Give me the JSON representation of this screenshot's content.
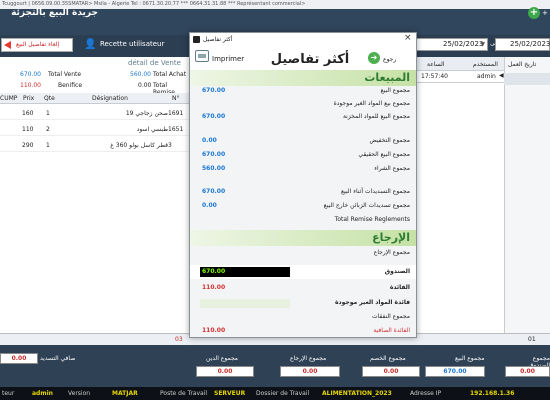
{
  "window": {
    "title_text": "Tcuggourt | 0656.09.00.35SMATAR> Msila - Algerie Tel : 0671.30.20.77 *** 0664.31.31.88 *** Représentant commercial>"
  },
  "header": {
    "app_title": "جريدة البيع بالتجزئة",
    "plus_label": "+"
  },
  "toolbar": {
    "cancel_label": "إلغاء تفاصيل البيع",
    "recette_label": "Recette utilisateur",
    "date_from_label": "من",
    "date_from": "25/02/2023",
    "date_to_label": "إلى",
    "date_to": "25/02/2023"
  },
  "left_panel": {
    "detail_title": "détail de Vente",
    "totals": [
      {
        "label_left": "Total Vente",
        "value_left": "670.00",
        "label_right": "Total Achat",
        "value_right": "560.00"
      },
      {
        "label_left": "Benifice",
        "value_left": "110.00",
        "label_right": "Total Remise",
        "value_right": "0.00"
      }
    ],
    "columns": [
      "CUMP",
      "Prix",
      "Qte",
      "Désignation",
      "N°"
    ],
    "rows": [
      {
        "cump": "",
        "prix": "160",
        "qte": "1",
        "designation": "صحن زجاجي 19",
        "num": "1691"
      },
      {
        "cump": "",
        "prix": "110",
        "qte": "2",
        "designation": "طبسي اسود",
        "num": "1651"
      },
      {
        "cump": "",
        "prix": "290",
        "qte": "1",
        "designation": "قطر كاسل بولو 360 غ",
        "num": "3"
      }
    ]
  },
  "right_panel": {
    "columns": [
      "الساعة",
      "المستخدم",
      "تاريخ العمل"
    ],
    "row": {
      "time": "17:57:40",
      "user": "admin"
    }
  },
  "pager": {
    "count": "03",
    "count_right": "01"
  },
  "summary": {
    "labels": [
      "صافي التسديد",
      "مجموع الدين",
      "مجموع الإرجاع",
      "مجموع الخصم",
      "مجموع البيع",
      "مجموع الصندوق"
    ],
    "values": [
      "0.00",
      "0.00",
      "0.00",
      "0.00",
      "670.00",
      "0.00"
    ]
  },
  "statusbar": {
    "user_label": "teur",
    "user_value": "admin",
    "version_label": "Version",
    "version_value": "MATJAR",
    "poste_label": "Poste de Travail",
    "poste_value": "SERVEUR",
    "dossier_label": "Dossier de Travail",
    "dossier_value": "ALIMENTATION_2023",
    "ip_label": "Adresse IP",
    "ip_value": "192.168.1.36"
  },
  "modal": {
    "window_title": "أكثر تفاصيل",
    "print_label": "Imprimer",
    "heading": "أكثر تفاصيل",
    "back_label": "رجوع",
    "sales_title": "المبيعات",
    "sales_rows": [
      {
        "label": "مجموع البيع",
        "value": "670.00"
      },
      {
        "label": "مجموع بيع المواد الغير موجودة",
        "value": ""
      },
      {
        "label": "مجموع البيع للمواد المخزنة",
        "value": "670.00"
      },
      {
        "label": "مجموع التخفيض",
        "value": "0.00"
      },
      {
        "label": "مجموع البيع الحقيقي",
        "value": "670.00"
      },
      {
        "label": "مجموع الشراء",
        "value": "560.00"
      },
      {
        "label": "مجموع التسديدات أثناء البيع",
        "value": "670.00"
      },
      {
        "label": "مجموع تسديدات الزبائن خارج البيع",
        "value": "0.00"
      },
      {
        "label": "Total Remise Reglements",
        "value": ""
      }
    ],
    "returns_title": "الإرجاع",
    "returns_rows": [
      {
        "label": "مجموع الإرجاع",
        "value": ""
      }
    ],
    "caisse_label": "الصندوق",
    "caisse_value": "670.00",
    "profit_label": "الفائدة",
    "profit_value": "110.00",
    "profit_missing_label": "فائدة المواد الغير موجودة",
    "expenses_label": "مجموع النفقات",
    "net_label": "الفائدة الصافية",
    "net_value": "110.00"
  },
  "colors": {
    "header_bg": "#30465c",
    "accent_green": "#2e7d32",
    "value_blue": "#1976d2",
    "value_red": "#d32f2f",
    "status_yellow": "#e6d600"
  }
}
